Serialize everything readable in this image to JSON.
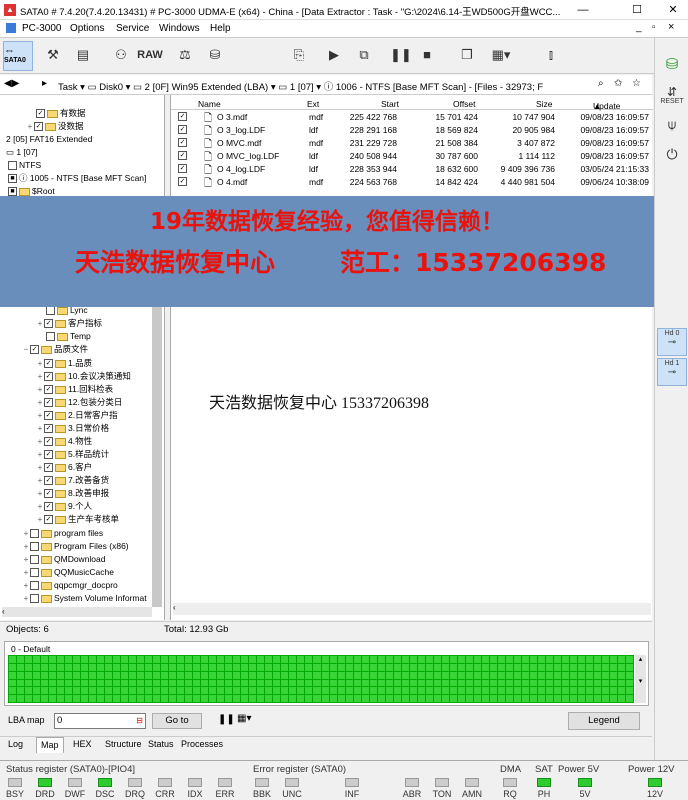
{
  "window": {
    "title": "SATA0 # 7.4.20(7.4.20.13431) # PC-3000 UDMA-E (x64) - China - [Data Extractor : Task - \"G:\\2024\\6.14-王WD500G开盘WCC...",
    "minimize": "—",
    "maximize": "☐",
    "close": "✕",
    "mdi_min": "_",
    "mdi_max": "▫",
    "mdi_close": "×"
  },
  "menu": {
    "app": "PC-3000",
    "items": [
      "Options",
      "Service",
      "Windows",
      "Help"
    ]
  },
  "toolbar": {
    "sata_label": "SATA0",
    "raw_label": "RAW"
  },
  "pathbar": {
    "task": "Task",
    "disk": "Disk0",
    "partition": "2 [0F] Win95 Extended  (LBA)",
    "sub": "1 [07]",
    "path": "1006 - NTFS [Base MFT Scan] - [Files - 32973; F"
  },
  "tree": {
    "top": [
      {
        "label": "有数据"
      },
      {
        "label": "没数据"
      },
      {
        "label": "2 [05] FAT16 Extended"
      },
      {
        "label": "1 [07]"
      },
      {
        "label": "NTFS"
      },
      {
        "label": "1005 - NTFS [Base MFT Scan]"
      },
      {
        "label": "$Root"
      }
    ],
    "mid": [
      {
        "label": "Lync"
      },
      {
        "label": "客户指标"
      },
      {
        "label": "Temp"
      },
      {
        "label": "品质文件"
      },
      {
        "label": "1.品质"
      },
      {
        "label": "10.会议决策通知"
      },
      {
        "label": "11.回料检表"
      },
      {
        "label": "12.包装分类日"
      },
      {
        "label": "2.日常客户指"
      },
      {
        "label": "3.日常价格"
      },
      {
        "label": "4.物性"
      },
      {
        "label": "5.样品统计"
      },
      {
        "label": "6.客户"
      },
      {
        "label": "7.改善备货"
      },
      {
        "label": "8.改善申报"
      },
      {
        "label": "9.个人"
      },
      {
        "label": "生产车考核单"
      },
      {
        "label": "program files"
      },
      {
        "label": "Program Files (x86)"
      },
      {
        "label": "QMDownload"
      },
      {
        "label": "QQMusicCache"
      },
      {
        "label": "qqpcmgr_docpro"
      },
      {
        "label": "System Volume Informat"
      }
    ]
  },
  "files": {
    "headers": {
      "name": "Name",
      "ext": "Ext",
      "start": "Start",
      "offset": "Offset",
      "size": "Size",
      "update": "Update"
    },
    "rows": [
      {
        "name": "O    3.mdf",
        "ext": "mdf",
        "start": "225 422 768",
        "offset": "15 701 424",
        "size": "10 747 904",
        "update": "09/08/23 16:09:57"
      },
      {
        "name": "O    3_log.LDF",
        "ext": "ldf",
        "start": "228 291 168",
        "offset": "18 569 824",
        "size": "20 905 984",
        "update": "09/08/23 16:09:57"
      },
      {
        "name": "O    MVC.mdf",
        "ext": "mdf",
        "start": "231 229 728",
        "offset": "21 508 384",
        "size": "3 407 872",
        "update": "09/08/23 16:09:57"
      },
      {
        "name": "O    MVC_log.LDF",
        "ext": "ldf",
        "start": "240 508 944",
        "offset": "30 787 600",
        "size": "1 114 112",
        "update": "09/08/23 16:09:57"
      },
      {
        "name": "O    4_log.LDF",
        "ext": "ldf",
        "start": "228 353 944",
        "offset": "18 632 600",
        "size": "9 409 396 736",
        "update": "03/05/24 21:15:33"
      },
      {
        "name": "O    4.mdf",
        "ext": "mdf",
        "start": "224 563 768",
        "offset": "14 842 424",
        "size": "4 440 981 504",
        "update": "09/06/24 10:38:09"
      }
    ]
  },
  "banner": {
    "line1": "19年数据恢复经验，您值得信赖！",
    "line2a": "天浩数据恢复中心",
    "line2b": "范工：15337206398"
  },
  "watermark": "天浩数据恢复中心 15337206398",
  "status": {
    "objects": "Objects: 6",
    "total": "Total: 12.93 Gb"
  },
  "map": {
    "title": "0 - Default",
    "lba_label": "LBA map",
    "lba_value": "0",
    "goto": "Go to",
    "legend": "Legend"
  },
  "tabs": [
    "Log",
    "Map",
    "HEX",
    "Structure",
    "Status",
    "Processes"
  ],
  "registers": {
    "status_title": "Status register (SATA0)-[PIO4]",
    "error_title": "Error register (SATA0)",
    "dma_title": "DMA",
    "sat_title": "SAT",
    "p5_title": "Power 5V",
    "p12_title": "Power 12V",
    "status_bits": [
      "BSY",
      "DRD",
      "DWF",
      "DSC",
      "DRQ",
      "CRR",
      "IDX",
      "ERR"
    ],
    "error_bits": [
      "BBK",
      "UNC",
      "INF",
      "ABR",
      "TON",
      "AMN"
    ],
    "dma_bit": "RQ",
    "sat_bit": "PH",
    "p5_bit": "5V",
    "p12_bit": "12V"
  },
  "side": {
    "reset": "RESET",
    "hd0": "Hd 0",
    "hd1": "Hd 1"
  }
}
